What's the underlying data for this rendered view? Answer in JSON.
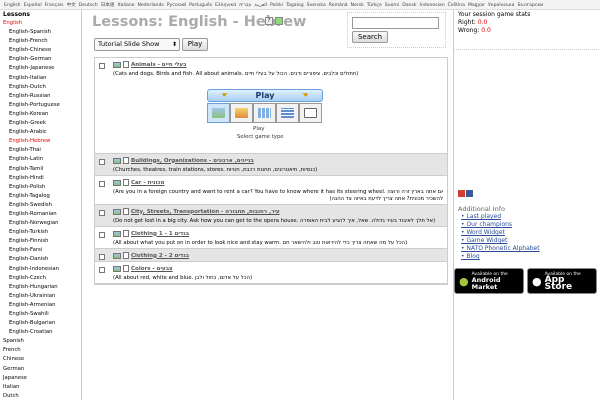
{
  "top_languages": [
    "English",
    "Español",
    "Français",
    "中文",
    "Deutsch",
    "日本語",
    "Italiano",
    "Nederlands",
    "Русский",
    "Português",
    "Ελληνικά",
    "العربية",
    "עברית",
    "Polski",
    "Tagalog",
    "Svenska",
    "Română",
    "Norsk",
    "Türkçe",
    "Suomi",
    "Dansk",
    "Indonesian",
    "Čeština",
    "Magyar",
    "Українська",
    "Български"
  ],
  "sidebar": {
    "title": "Lessons",
    "items": [
      {
        "label": "English",
        "active": true,
        "sub": false
      },
      {
        "label": "English-Spanish",
        "sub": true
      },
      {
        "label": "English-French",
        "sub": true
      },
      {
        "label": "English-Chinese",
        "sub": true
      },
      {
        "label": "English-German",
        "sub": true
      },
      {
        "label": "English-Japanese",
        "sub": true
      },
      {
        "label": "English-Italian",
        "sub": true
      },
      {
        "label": "English-Dutch",
        "sub": true
      },
      {
        "label": "English-Russian",
        "sub": true
      },
      {
        "label": "English-Portuguese",
        "sub": true
      },
      {
        "label": "English-Korean",
        "sub": true
      },
      {
        "label": "English-Greek",
        "sub": true
      },
      {
        "label": "English-Arabic",
        "sub": true
      },
      {
        "label": "English-Hebrew",
        "sub": true,
        "active": true
      },
      {
        "label": "English-Thai",
        "sub": true
      },
      {
        "label": "English-Latin",
        "sub": true
      },
      {
        "label": "English-Tamil",
        "sub": true
      },
      {
        "label": "English-Hindi",
        "sub": true
      },
      {
        "label": "English-Polish",
        "sub": true
      },
      {
        "label": "English-Tagalog",
        "sub": true
      },
      {
        "label": "English-Swedish",
        "sub": true
      },
      {
        "label": "English-Romanian",
        "sub": true
      },
      {
        "label": "English-Norwegian",
        "sub": true
      },
      {
        "label": "English-Turkish",
        "sub": true
      },
      {
        "label": "English-Finnish",
        "sub": true
      },
      {
        "label": "English-Farsi",
        "sub": true
      },
      {
        "label": "English-Danish",
        "sub": true
      },
      {
        "label": "English-Indonesian",
        "sub": true
      },
      {
        "label": "English-Czech",
        "sub": true
      },
      {
        "label": "English-Hungarian",
        "sub": true
      },
      {
        "label": "English-Ukrainian",
        "sub": true
      },
      {
        "label": "English-Armenian",
        "sub": true
      },
      {
        "label": "English-Swahili",
        "sub": true
      },
      {
        "label": "English-Bulgarian",
        "sub": true
      },
      {
        "label": "English-Croatian",
        "sub": true
      },
      {
        "label": "Spanish",
        "sub": false
      },
      {
        "label": "French",
        "sub": false
      },
      {
        "label": "Chinese",
        "sub": false
      },
      {
        "label": "German",
        "sub": false
      },
      {
        "label": "Japanese",
        "sub": false
      },
      {
        "label": "Italian",
        "sub": false
      },
      {
        "label": "Dutch",
        "sub": false
      }
    ]
  },
  "main": {
    "title": "Lessons: English - Hebrew",
    "search_button": "Search",
    "mode_select": "Tutorial Slide Show",
    "play_button": "Play",
    "big_play": "Play",
    "game_play_label": "Play",
    "game_type_label": "Select game type"
  },
  "lessons": [
    {
      "title": "Animals - בעלי חיים",
      "desc": "(Cats and dogs. Birds and fish. All about animals. חתולים וכלבים. ציפורים ודגים. הכול על בעלי חיים)",
      "desc2": "",
      "alt": false,
      "expanded": true
    },
    {
      "title": "Buildings, Organizations - בניינים, ארגונים",
      "desc": "(Churches, theatres, train stations, stores. כנסיות, תיאטרונים, תחנות רכבת, חנויות)",
      "desc2": "",
      "alt": true
    },
    {
      "title": "Car - מכונית",
      "desc": "(Are you in a foreign country and want to rent a car? You have to know where it has its steering wheel. האם אתה בארץ זרה ורוצה",
      "desc2": "(להשכיר מכונית? אתה צריך לדעת באיזה צד ההגה",
      "alt": false
    },
    {
      "title": "City, Streets, Transportation - עיר, רחובות, תחבורה",
      "desc": "(Do not get lost in a big city. Ask how you can get to the opera house. אל תלך לאיבוד בעיר גדולה. שאל, איך להגיע לבית האופרה)",
      "desc2": "",
      "alt": true
    },
    {
      "title": "Clothing 1 - בגדים 1",
      "desc": "(All about what you put on in order to look nice and stay warm. הכל על מה שאתה צריך כדי להיראות טוב ולהישאר חם)",
      "desc2": "",
      "alt": false
    },
    {
      "title": "Clothing 2 - בגדים 2",
      "desc": "",
      "desc2": "",
      "alt": true
    },
    {
      "title": "Colors - צבעים",
      "desc": "(All about red, white and blue. הכל על אדום, כחול ולבן)",
      "desc2": "",
      "alt": false
    }
  ],
  "right": {
    "stats_title": "Your session game stats",
    "right_label": "Right:",
    "right_value": "0.0",
    "wrong_label": "Wrong:",
    "wrong_value": "0.0",
    "info_title": "Additional Info",
    "info_links": [
      "Last played",
      "Our champions",
      "Word Widget",
      "Game Widget",
      "NATO Phonetic Alphabet",
      "Blog"
    ],
    "android_small": "Available on the",
    "android_big": "Android Market",
    "apple_small": "Available on the",
    "apple_big": "App Store"
  }
}
